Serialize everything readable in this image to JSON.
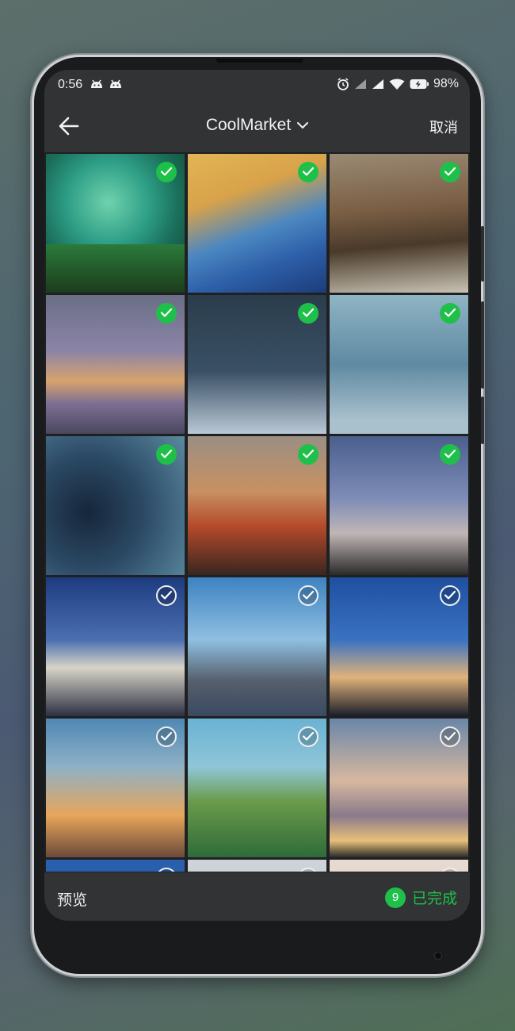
{
  "status_bar": {
    "time": "0:56",
    "battery": "98%"
  },
  "header": {
    "album_name": "CoolMarket",
    "cancel_label": "取消"
  },
  "photos": [
    {
      "selected": true
    },
    {
      "selected": true
    },
    {
      "selected": true
    },
    {
      "selected": true
    },
    {
      "selected": true
    },
    {
      "selected": true
    },
    {
      "selected": true
    },
    {
      "selected": true
    },
    {
      "selected": true
    },
    {
      "selected": false
    },
    {
      "selected": false
    },
    {
      "selected": false
    },
    {
      "selected": false
    },
    {
      "selected": false
    },
    {
      "selected": false
    },
    {
      "selected": false
    },
    {
      "selected": false
    },
    {
      "selected": false
    }
  ],
  "bottom_bar": {
    "preview_label": "预览",
    "selected_count": "9",
    "done_label": "已完成"
  },
  "colors": {
    "accent": "#1ec04a",
    "bar_background": "#323335"
  },
  "icons": {
    "back": "arrow-left-icon",
    "dropdown": "chevron-down-icon",
    "check": "check-icon"
  }
}
